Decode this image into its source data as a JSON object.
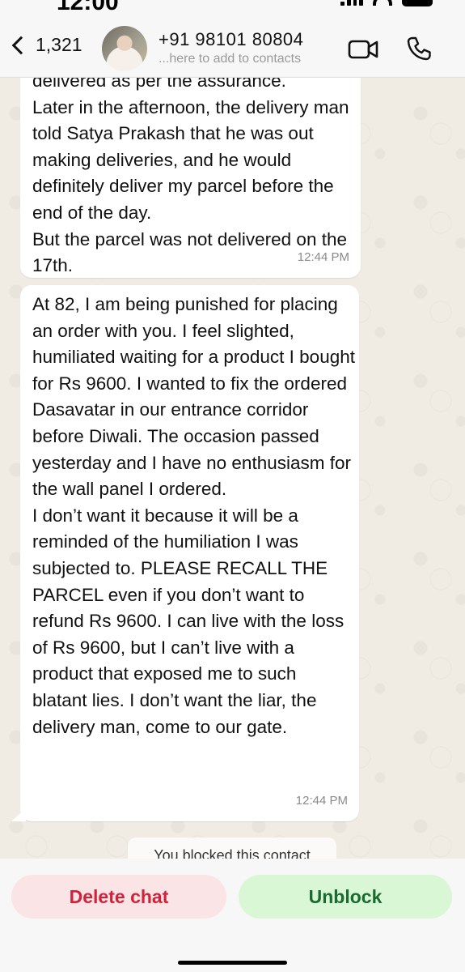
{
  "status_bar": {
    "time": "12:00"
  },
  "header": {
    "back_count": "1,321",
    "contact_name": "+91 98101 80804",
    "contact_subtitle": "...here to add to contacts"
  },
  "messages": [
    {
      "text": "delivered as per the assurance.\nLater in the afternoon, the delivery man told Satya Prakash that he was out making deliveries, and he would definitely deliver my parcel before the end of the day.\nBut the parcel was not delivered on the 17th.",
      "time": "12:44 PM"
    },
    {
      "text": "At 82, I am being punished for placing an order with you. I feel slighted, humiliated waiting for a product I bought for Rs 9600. I wanted to fix the ordered Dasavatar in our entrance corridor before Diwali. The occasion passed yesterday and I have no enthusiasm for the wall panel I ordered.\nI don’t want it because it will be a reminded of the humiliation I was subjected to. PLEASE RECALL THE PARCEL even if you don’t want to refund Rs 9600. I can live with the loss of Rs 9600, but I can’t live with a product that exposed me to such blatant lies. I don’t want the liar, the delivery man, come to our gate.",
      "time": "12:44 PM"
    }
  ],
  "system_notice": "You blocked this contact",
  "actions": {
    "delete_label": "Delete chat",
    "unblock_label": "Unblock"
  },
  "colors": {
    "delete_text": "#d0233a",
    "delete_bg": "#fbe4e6",
    "unblock_text": "#1a6b32",
    "unblock_bg": "#d9f7d4"
  }
}
